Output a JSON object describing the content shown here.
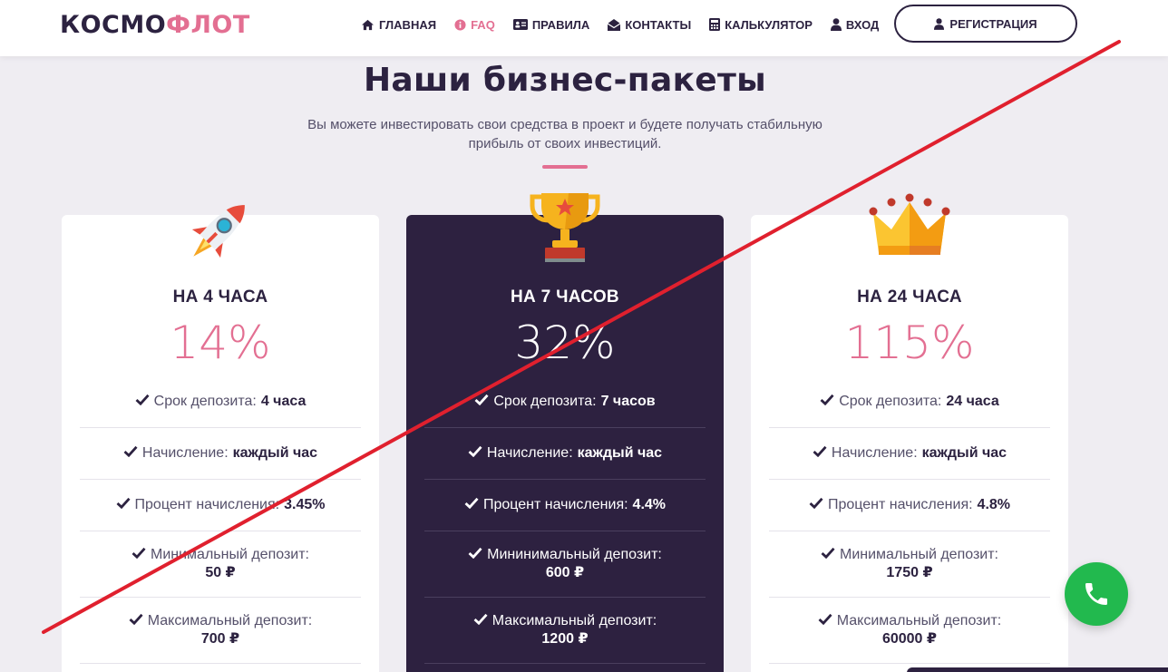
{
  "header": {
    "logo": {
      "part1": "КОСМО",
      "part2": "ФЛОТ"
    },
    "nav": [
      {
        "label": "ГЛАВНАЯ",
        "icon": "home-icon"
      },
      {
        "label": "FAQ",
        "icon": "info-icon",
        "active": true
      },
      {
        "label": "ПРАВИЛА",
        "icon": "id-card-icon"
      },
      {
        "label": "КОНТАКТЫ",
        "icon": "envelope-icon"
      },
      {
        "label": "КАЛЬКУЛЯТОР",
        "icon": "calculator-icon"
      },
      {
        "label": "ВХОД",
        "icon": "user-icon"
      }
    ],
    "register_label": "РЕГИСТРАЦИЯ"
  },
  "section": {
    "title": "Наши бизнес-пакеты",
    "subtitle_line1": "Вы можете инвестировать свои средства в проект и будете получать стабильную",
    "subtitle_line2": "прибыль от своих инвестиций."
  },
  "packages": [
    {
      "icon": "rocket-icon",
      "title": "НА 4 ЧАСА",
      "percent": "14%",
      "rows": [
        {
          "label": "Срок депозита:",
          "value": "4 часа"
        },
        {
          "label": "Начисление:",
          "value": "каждый час"
        },
        {
          "label": "Процент начисления:",
          "value": "3.45%"
        },
        {
          "label": "Минимальный депозит:",
          "value": "50 ₽"
        },
        {
          "label": "Максимальный депозит:",
          "value": "700 ₽"
        }
      ]
    },
    {
      "icon": "trophy-icon",
      "title": "НА 7 ЧАСОВ",
      "percent": "32%",
      "rows": [
        {
          "label": "Срок депозита:",
          "value": "7 часов"
        },
        {
          "label": "Начисление:",
          "value": "каждый час"
        },
        {
          "label": "Процент начисления:",
          "value": "4.4%"
        },
        {
          "label": "Мининимальный депозит:",
          "value": "600 ₽"
        },
        {
          "label": "Максимальный депозит:",
          "value": "1200 ₽"
        }
      ]
    },
    {
      "icon": "crown-icon",
      "title": "НА 24 ЧАСА",
      "percent": "115%",
      "rows": [
        {
          "label": "Срок депозита:",
          "value": "24 часа"
        },
        {
          "label": "Начисление:",
          "value": "каждый час"
        },
        {
          "label": "Процент начисления:",
          "value": "4.8%"
        },
        {
          "label": "Минимальный депозит:",
          "value": "1750 ₽"
        },
        {
          "label": "Максимальный депозит:",
          "value": "60000 ₽"
        }
      ]
    }
  ],
  "colors": {
    "accent": "#e36f92",
    "dark": "#2d2140",
    "background": "#efedf2",
    "phone": "#22b94e",
    "strike": "#e0202e"
  }
}
